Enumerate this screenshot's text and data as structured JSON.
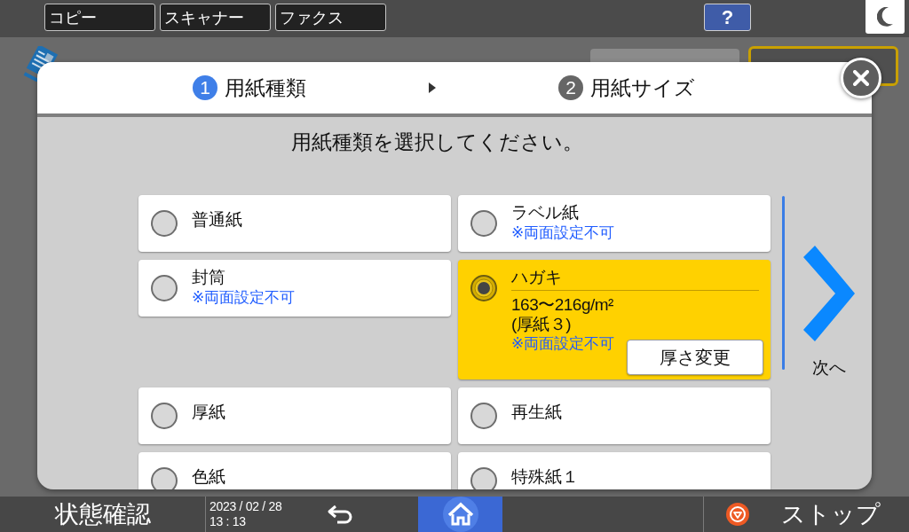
{
  "top_bar": {
    "app_buttons": [
      "コピー",
      "スキャナー",
      "ファクス"
    ],
    "help_button": "?"
  },
  "dialog": {
    "steps": [
      {
        "number": "1",
        "label": "用紙種類",
        "selected": true
      },
      {
        "number": "2",
        "label": "用紙サイズ",
        "selected": false
      }
    ],
    "instruction": "用紙種類を選択してください。",
    "paper_types": [
      {
        "name": "普通紙",
        "selected": false
      },
      {
        "name": "ラベル紙",
        "note": "※両面設定不可",
        "selected": false
      },
      {
        "name": "封筒",
        "note": "※両面設定不可",
        "selected": false
      },
      {
        "name": "ハガキ",
        "details": [
          "163〜216g/m²",
          "(厚紙３)"
        ],
        "note": "※両面設定不可",
        "button": "厚さ変更",
        "selected": true
      },
      {
        "name": "厚紙",
        "selected": false
      },
      {
        "name": "再生紙",
        "selected": false
      },
      {
        "name": "色紙",
        "selected": false
      },
      {
        "name": "特殊紙１",
        "selected": false
      }
    ],
    "next_button": "次へ"
  },
  "bottom_bar": {
    "status_button": "状態確認",
    "date": "2023 / 02 / 28",
    "time": "13 : 13",
    "stop_button": "ストップ"
  }
}
